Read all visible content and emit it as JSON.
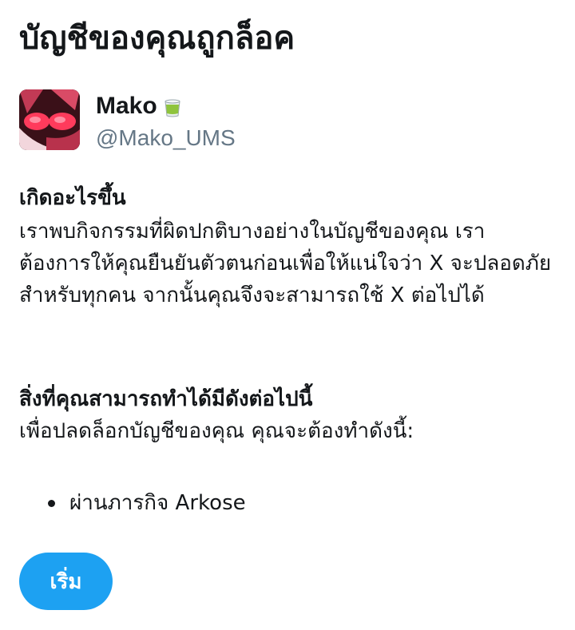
{
  "page": {
    "title": "บัญชีของคุณถูกล็อค"
  },
  "account": {
    "display_name": "Mako",
    "emoji_icon": "tea-cup-icon",
    "handle": "@Mako_UMS"
  },
  "what_happened": {
    "heading": "เกิดอะไรขึ้น",
    "body": "เราพบกิจกรรมที่ผิดปกติบางอย่างในบัญชีของคุณ เราต้องการให้คุณยืนยันตัวตนก่อนเพื่อให้แน่ใจว่า X จะปลอดภัยสำหรับทุกคน จากนั้นคุณจึงจะสามารถใช้ X ต่อไปได้"
  },
  "what_next": {
    "heading": "สิ่งที่คุณสามารถทำได้มีดังต่อไปนี้",
    "body": "เพื่อปลดล็อกบัญชีของคุณ คุณจะต้องทำดังนี้:"
  },
  "steps": [
    "ผ่านภารกิจ Arkose"
  ],
  "actions": {
    "start_label": "เริ่ม"
  },
  "colors": {
    "accent": "#1da1f2",
    "text": "#14171a",
    "secondary_text": "#657786"
  }
}
